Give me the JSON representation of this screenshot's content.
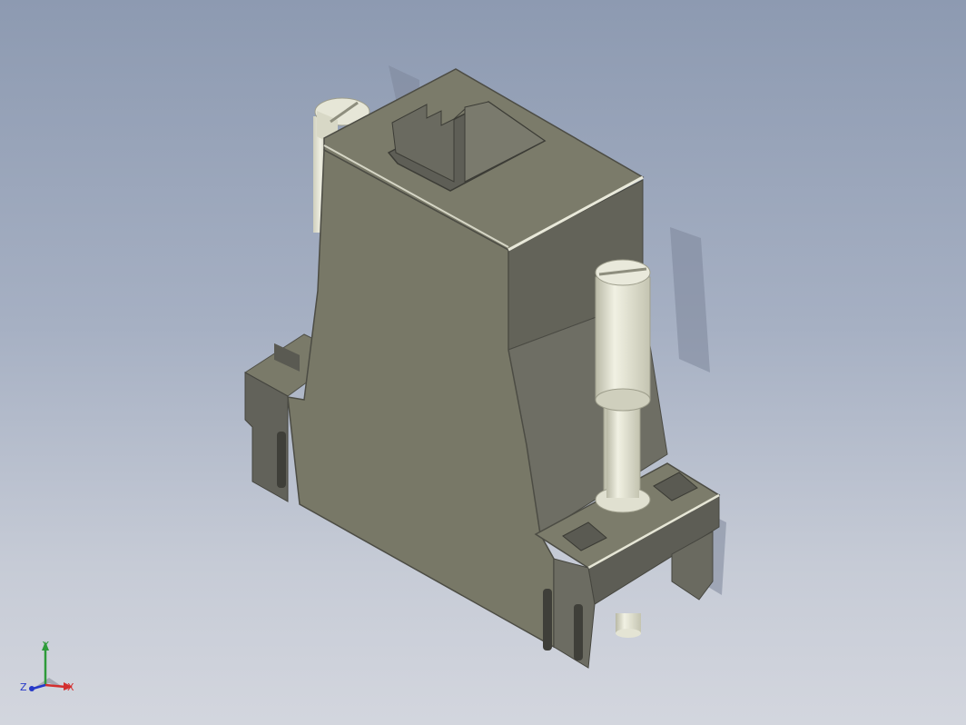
{
  "viewport": {
    "background_top": "#8d9ab1",
    "background_bottom": "#d3d6de"
  },
  "model": {
    "body_color": "#787867",
    "body_shadow_color": "#5d5d55",
    "screw_color": "#dcdcc9"
  },
  "triad": {
    "x_label": "X",
    "y_label": "Y",
    "z_label": "Z",
    "x_color": "#d32f2f",
    "y_color": "#2e9b3a",
    "z_color": "#2638c8"
  }
}
